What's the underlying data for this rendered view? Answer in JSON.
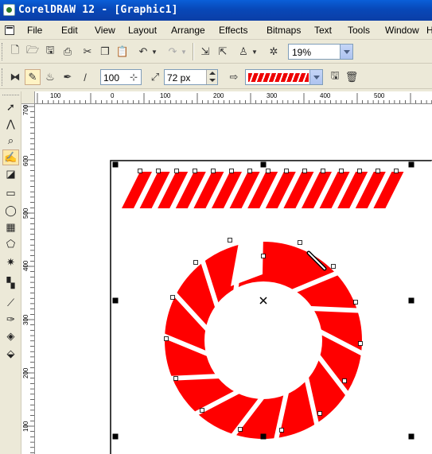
{
  "window": {
    "title": "CorelDRAW 12 - [Graphic1]"
  },
  "menu": {
    "items": [
      "File",
      "Edit",
      "View",
      "Layout",
      "Arrange",
      "Effects",
      "Bitmaps",
      "Text",
      "Tools",
      "Window",
      "H"
    ]
  },
  "toolbar": {
    "zoom": "19%",
    "standard_icons": [
      "new-icon",
      "open-icon",
      "save-icon",
      "print-icon",
      "cut-icon",
      "copy-icon",
      "paste-icon",
      "undo-icon",
      "redo-icon",
      "import-icon",
      "export-icon",
      "launcher-icon",
      "options-icon"
    ]
  },
  "property_bar": {
    "smoothness": "100",
    "stroke_width": "72 px",
    "icons": [
      "artistic-media-icon",
      "preset-icon",
      "brush-icon",
      "sprayer-icon",
      "calligraphic-icon",
      "pressure-icon",
      "width-icon",
      "freehand-smoothing-icon",
      "apply-icon",
      "save-stroke-icon",
      "delete-stroke-icon"
    ]
  },
  "rulers": {
    "horizontal": [
      "100",
      "0",
      "100",
      "200",
      "300",
      "400",
      "500"
    ],
    "vertical": [
      "700",
      "600",
      "500",
      "400",
      "300",
      "200",
      "100"
    ]
  },
  "colors": {
    "accent": "#FF0000",
    "titlebar": "#0A5FD8",
    "chrome": "#ECE9D8"
  }
}
